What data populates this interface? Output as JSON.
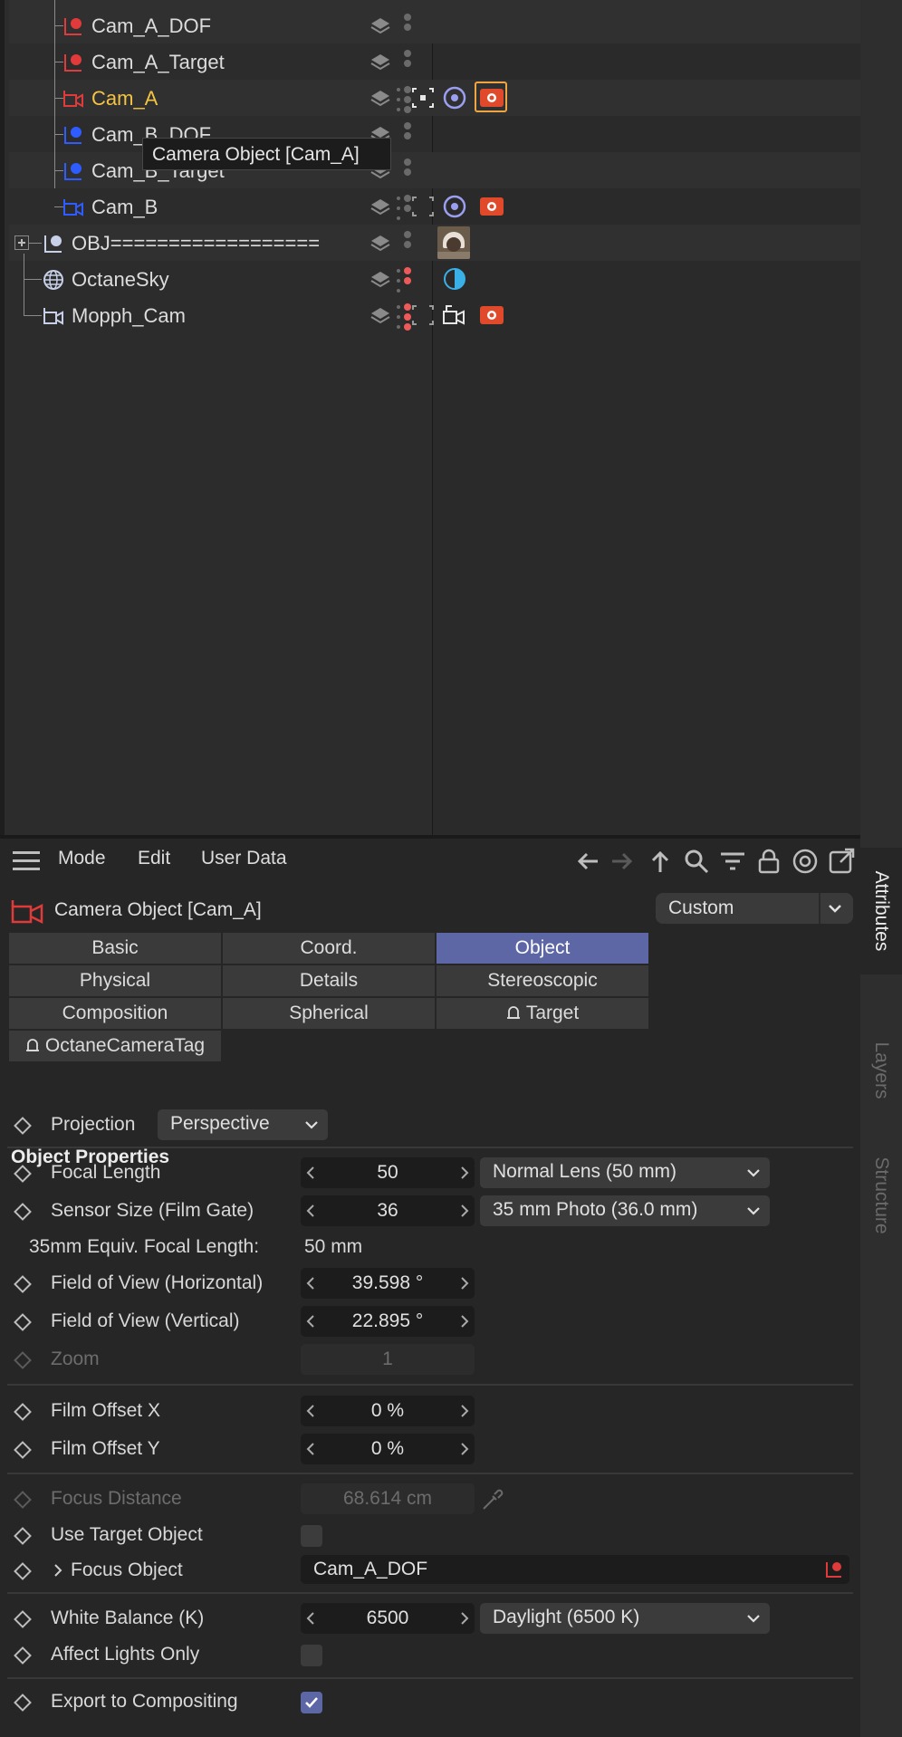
{
  "object_manager": {
    "tooltip": "Camera Object [Cam_A]",
    "rows": [
      {
        "name": "Cam_A_DOF"
      },
      {
        "name": "Cam_A_Target"
      },
      {
        "name": "Cam_A"
      },
      {
        "name": "Cam_B_DOF"
      },
      {
        "name": "Cam_B_Target"
      },
      {
        "name": "Cam_B"
      },
      {
        "name": "OBJ=================="
      },
      {
        "name": "OctaneSky"
      },
      {
        "name": "Mopph_Cam"
      }
    ]
  },
  "attributes": {
    "menu": {
      "mode": "Mode",
      "edit": "Edit",
      "user_data": "User Data"
    },
    "title": "Camera Object [Cam_A]",
    "preset": "Custom",
    "tabs": [
      {
        "label": "Basic"
      },
      {
        "label": "Coord."
      },
      {
        "label": "Object"
      },
      {
        "label": "Physical"
      },
      {
        "label": "Details"
      },
      {
        "label": "Stereoscopic"
      },
      {
        "label": "Composition"
      },
      {
        "label": "Spherical"
      },
      {
        "label": "Target"
      },
      {
        "label": "OctaneCameraTag"
      }
    ],
    "section_title": "Object Properties",
    "projection": {
      "label": "Projection",
      "value": "Perspective"
    },
    "focal_length": {
      "label": "Focal Length",
      "value": "50",
      "preset": "Normal Lens (50 mm)"
    },
    "sensor_size": {
      "label": "Sensor Size (Film Gate)",
      "value": "36",
      "preset": "35 mm Photo (36.0 mm)"
    },
    "equiv": {
      "label": "35mm Equiv. Focal Length:",
      "value": "50 mm"
    },
    "fov_h": {
      "label": "Field of View (Horizontal)",
      "value": "39.598 °"
    },
    "fov_v": {
      "label": "Field of View (Vertical)",
      "value": "22.895 °"
    },
    "zoom": {
      "label": "Zoom",
      "value": "1"
    },
    "film_offset_x": {
      "label": "Film Offset X",
      "value": "0 %"
    },
    "film_offset_y": {
      "label": "Film Offset Y",
      "value": "0 %"
    },
    "focus_distance": {
      "label": "Focus Distance",
      "value": "68.614 cm"
    },
    "use_target": {
      "label": "Use Target Object",
      "checked": false
    },
    "focus_object": {
      "label": "Focus Object",
      "value": "Cam_A_DOF"
    },
    "white_balance": {
      "label": "White Balance (K)",
      "value": "6500",
      "preset": "Daylight (6500 K)"
    },
    "affect_lights": {
      "label": "Affect Lights Only",
      "checked": false
    },
    "export_comp": {
      "label": "Export to Compositing",
      "checked": true
    }
  },
  "side_tabs": {
    "attributes": "Attributes",
    "layers": "Layers",
    "structure": "Structure"
  },
  "colors": {
    "accent": "#5e67a6",
    "active_name": "#f3c343",
    "camera_red": "#e03a3a",
    "camera_blue": "#2f5cff"
  }
}
